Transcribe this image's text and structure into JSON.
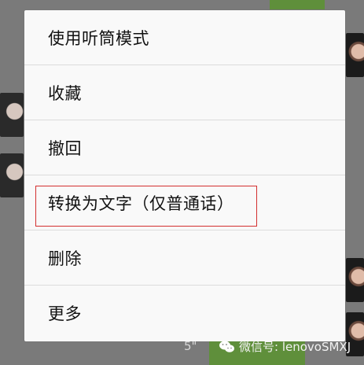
{
  "menu": {
    "items": [
      {
        "label": "使用听筒模式"
      },
      {
        "label": "收藏"
      },
      {
        "label": "撤回"
      },
      {
        "label": "转换为文字（仅普通话）"
      },
      {
        "label": "删除"
      },
      {
        "label": "更多"
      }
    ],
    "highlighted_index": 3
  },
  "chat": {
    "voice_duration": "5\""
  },
  "watermark": {
    "text": "微信号: lenovoSMXJ"
  },
  "colors": {
    "highlight": "#d32f2f",
    "bubble": "#5f8f3b"
  },
  "icons": {
    "watermark_icon": "wechat-icon"
  }
}
